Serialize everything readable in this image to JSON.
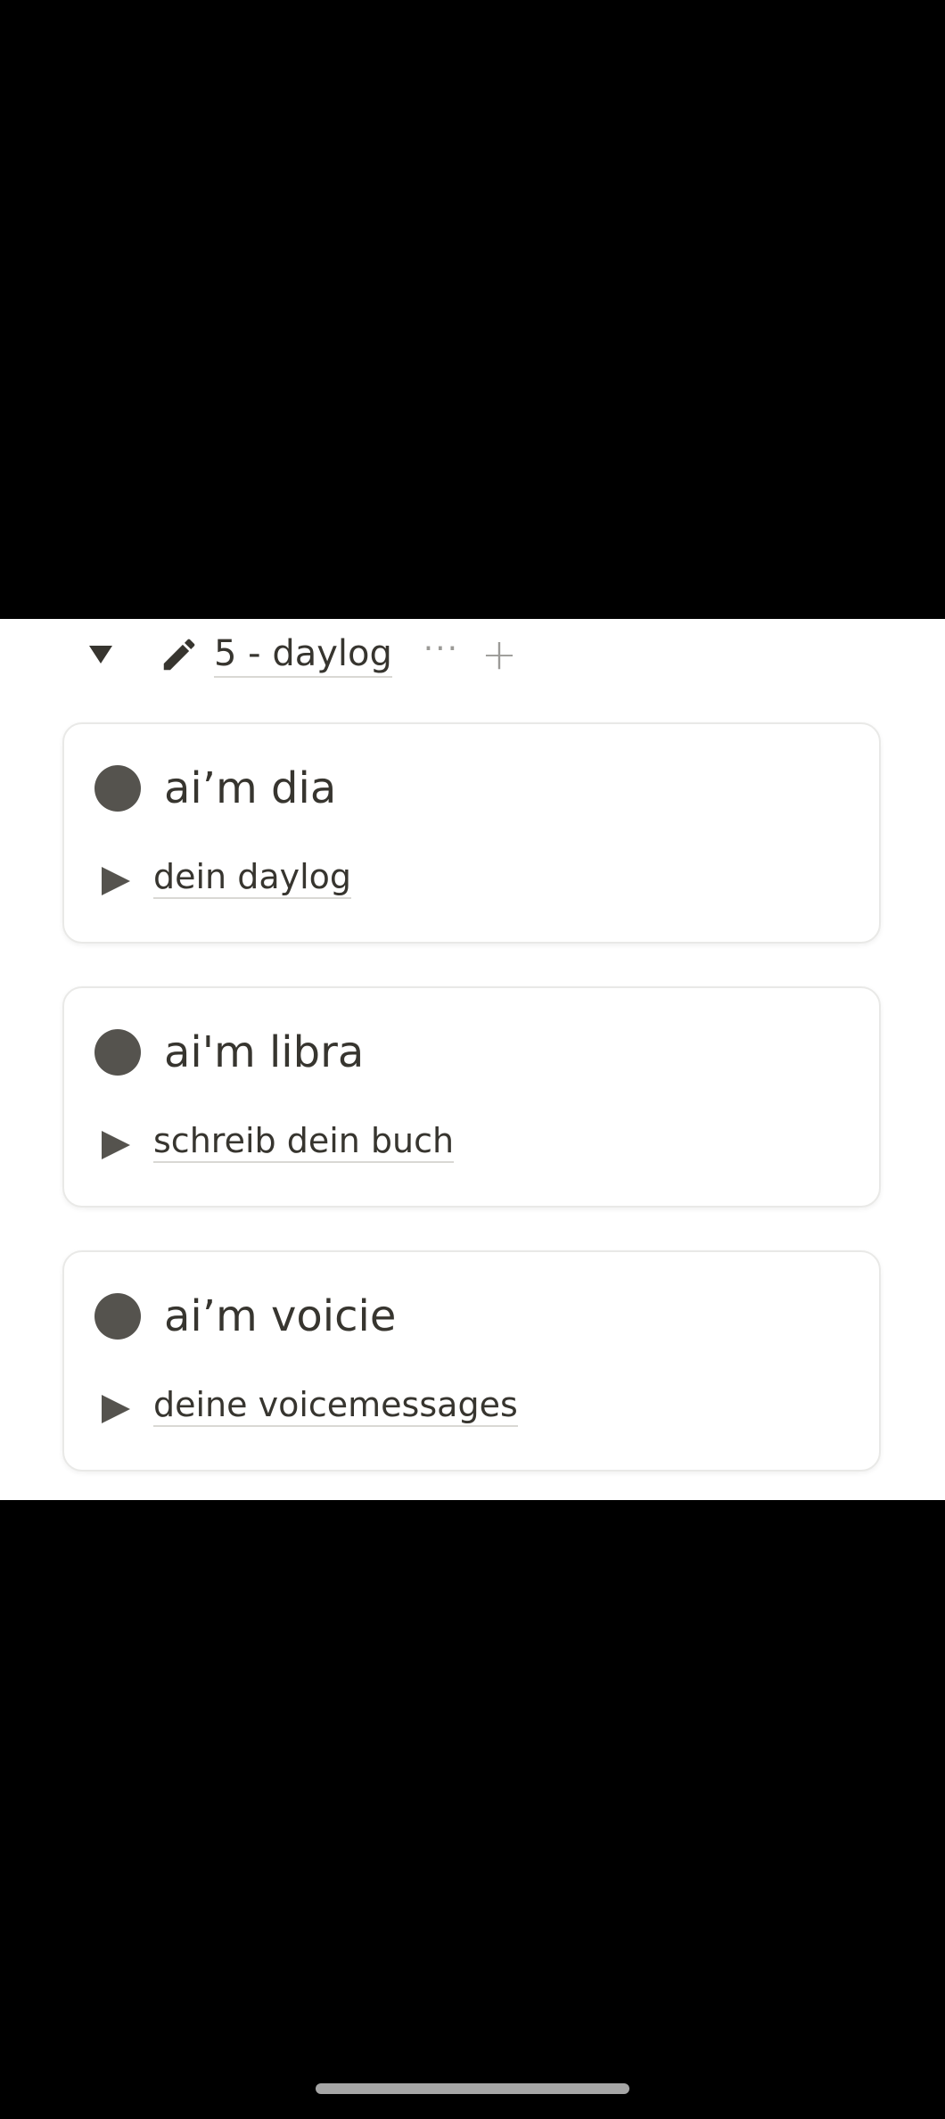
{
  "group": {
    "title": "5 - daylog",
    "toggle_icon": "triangle-down-icon",
    "edit_icon": "pencil-icon",
    "more_label": "···",
    "add_label": "+"
  },
  "cards": [
    {
      "title": "ai’m dia",
      "subtitle": "dein daylog"
    },
    {
      "title": "ai'm libra",
      "subtitle": "schreib dein buch"
    },
    {
      "title": "ai’m voicie",
      "subtitle": "deine voicemessages"
    }
  ],
  "colors": {
    "background": "#000000",
    "surface": "#ffffff",
    "text": "#37352f",
    "icon": "#55534e",
    "muted": "#9b9a97",
    "border": "#e9e9e7",
    "home_indicator": "#a6a6a6"
  }
}
